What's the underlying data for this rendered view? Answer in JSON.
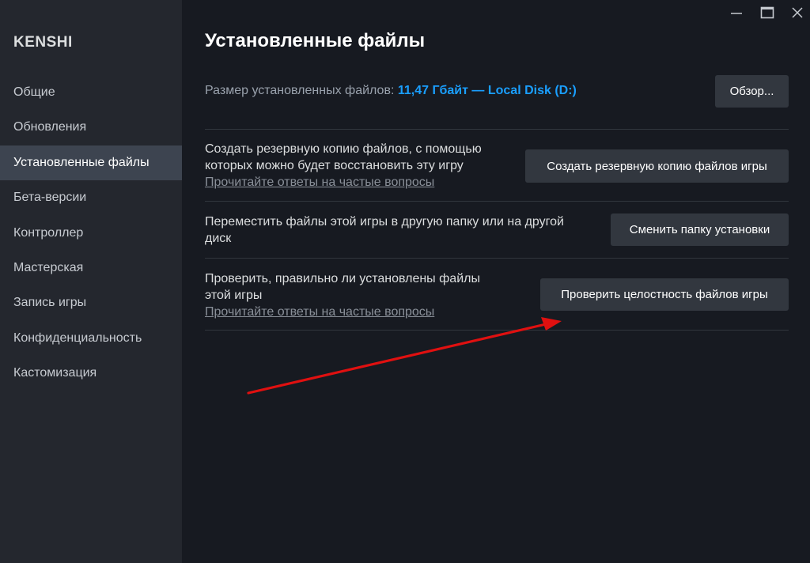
{
  "sidebar": {
    "app_title": "KENSHI",
    "items": [
      {
        "label": "Общие"
      },
      {
        "label": "Обновления"
      },
      {
        "label": "Установленные файлы"
      },
      {
        "label": "Бета-версии"
      },
      {
        "label": "Контроллер"
      },
      {
        "label": "Мастерская"
      },
      {
        "label": "Запись игры"
      },
      {
        "label": "Конфиденциальность"
      },
      {
        "label": "Кастомизация"
      }
    ],
    "active_index": 2
  },
  "main": {
    "title": "Установленные файлы",
    "size_label": "Размер установленных файлов:",
    "size_value": "11,47 Гбайт — Local Disk (D:)",
    "browse_button": "Обзор...",
    "rows": [
      {
        "line1": "Создать резервную копию файлов, с помощью",
        "line2": "которых можно будет восстановить эту игру",
        "link": "Прочитайте ответы на частые вопросы",
        "button": "Создать резервную копию файлов игры"
      },
      {
        "line1": "Переместить файлы этой игры в другую папку или на другой",
        "line2": "диск",
        "button": "Сменить папку установки"
      },
      {
        "line1": "Проверить, правильно ли установлены файлы",
        "line2": "этой игры",
        "link": "Прочитайте ответы на частые вопросы",
        "button": "Проверить целостность файлов игры"
      }
    ]
  },
  "window_controls": [
    "minimize-icon",
    "maximize-icon",
    "close-icon"
  ],
  "colors": {
    "background": "#171a21",
    "sidebar": "#24272e",
    "active_item": "#3d4450",
    "accent": "#1a9fff",
    "button": "#32373f",
    "annotation_arrow": "#e01010"
  }
}
